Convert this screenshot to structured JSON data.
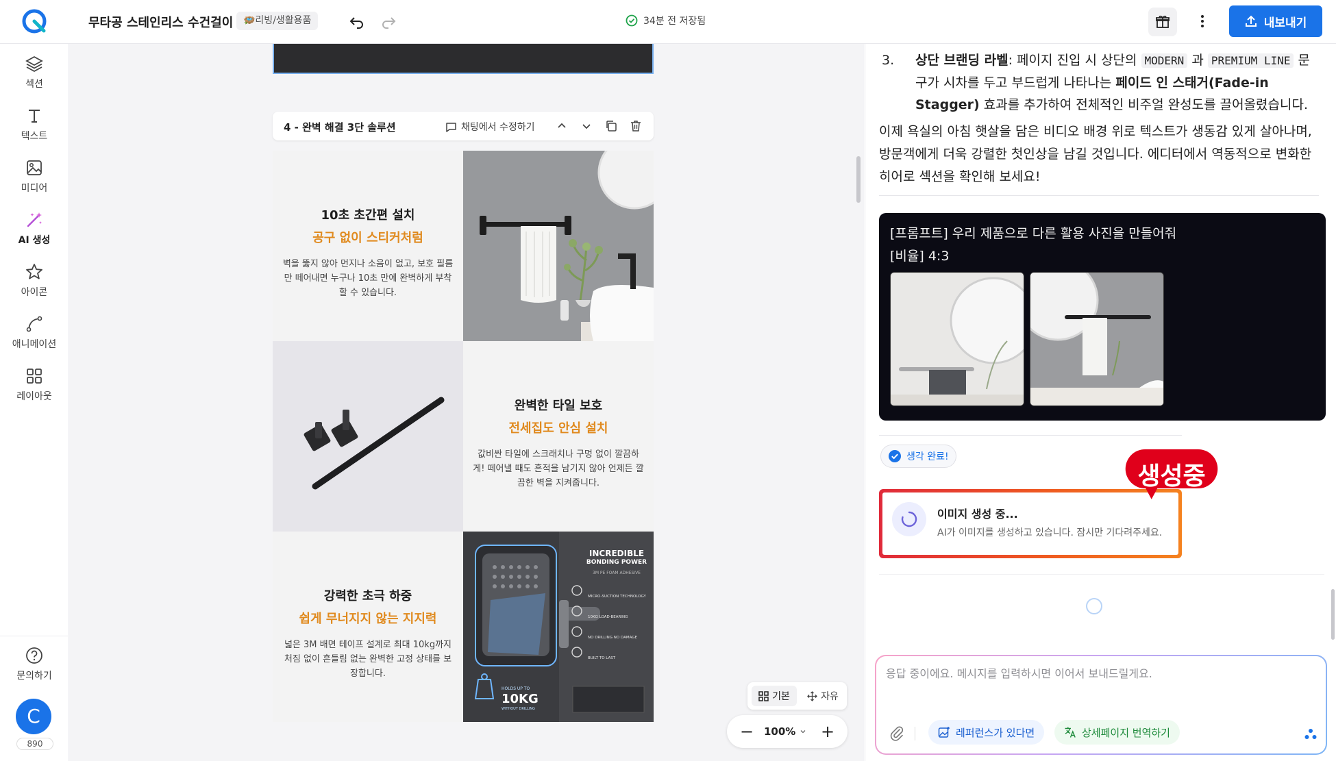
{
  "topbar": {
    "doc_title": "무타공 스테인리스 수건걸이",
    "category": "🪺리빙/생활용품",
    "save_status": "34분 전 저장됨",
    "export_label": "내보내기"
  },
  "sidebar": {
    "items": [
      {
        "label": "섹션",
        "icon": "layers-icon"
      },
      {
        "label": "텍스트",
        "icon": "text-icon"
      },
      {
        "label": "미디어",
        "icon": "image-icon"
      },
      {
        "label": "AI 생성",
        "icon": "magic-wand-icon"
      },
      {
        "label": "아이콘",
        "icon": "star-icon"
      },
      {
        "label": "애니메이션",
        "icon": "curve-icon"
      },
      {
        "label": "레이아웃",
        "icon": "grid-icon"
      }
    ],
    "help_label": "문의하기",
    "avatar_initial": "C",
    "credits": "890",
    "ai_color": "#b44fd6"
  },
  "canvas": {
    "section_title": "4 - 완벽 해결 3단 솔루션",
    "edit_in_chat": "채팅에서 수정하기",
    "features": [
      {
        "title": "10초 초간편 설치",
        "subtitle": "공구 없이 스티커처럼",
        "body": "벽을 뚫지 않아 먼지나 소음이 없고, 보호 필름만 떼어내면 누구나 10초 만에 완벽하게 부착할 수 있습니다."
      },
      {
        "title": "완벽한 타일 보호",
        "subtitle": "전세집도 안심 설치",
        "body": "값비싼 타일에 스크래치나 구멍 없이 깔끔하게! 떼어낼 때도 흔적을 남기지 않아 언제든 깔끔한 벽을 지켜줍니다."
      },
      {
        "title": "강력한 초극 하중",
        "subtitle": "쉽게 무너지지 않는 지지력",
        "body": "넓은 3M 배면 테이프 설계로 최대 10kg까지 처짐 없이 흔들림 없는 완벽한 고정 상태를 보장합니다."
      }
    ],
    "poster": {
      "headline": "INCREDIBLE",
      "headline2": "BONDING POWER",
      "tagline": "3M PE FOAM ADHESIVE",
      "specs": [
        "MICRO-SUCTION TECHNOLOGY",
        "10KG LOAD-BEARING",
        "NO DRILLING NO DAMAGE",
        "BUILT TO LAST"
      ],
      "holds_label": "HOLDS UP TO",
      "weight": "10KG",
      "weight_sub": "WITHOUT DRILLING"
    },
    "view_basic": "기본",
    "view_free": "자유",
    "zoom": "100%",
    "accent_orange": "#e08a1e"
  },
  "chat": {
    "list_num": "3.",
    "list_bold": "상단 브랜딩 라벨",
    "list_text1": ": 페이지 진입 시 상단의 ",
    "code1": "MODERN",
    "list_and": " 과 ",
    "code2": "PREMIUM LINE",
    "list_text2": " 문구가 시차를 두고 부드럽게 나타나는 ",
    "list_bold2": "페이드 인 스태거(Fade-in Stagger)",
    "list_text3": " 효과를 추가하여 전체적인 비주얼 완성도를 끌어올렸습니다.",
    "paragraph": "이제 욕실의 아침 햇살을 담은 비디오 배경 위로 텍스트가 생동감 있게 살아나며, 방문객에게 더욱 강렬한 첫인상을 남길 것입니다. 에디터에서 역동적으로 변화한 히어로 섹션을 확인해 보세요!",
    "prompt_line1": "[프롬프트] 우리 제품으로 다른 활용 사진을 만들어줘",
    "prompt_line2": "[비율] 4:3",
    "thinking_done": "생각 완료!",
    "gen_title": "이미지 생성 중...",
    "gen_desc": "AI가 이미지를 생성하고 있습니다. 잠시만 기다려주세요.",
    "badge": "생성중",
    "input_placeholder": "응답 중이에요. 메시지를 입력하시면 이어서 보내드릴게요.",
    "chip_reference": "레퍼런스가 있다면",
    "chip_translate": "상세페이지 번역하기",
    "brand_blue": "#1a73e8",
    "badge_red": "#e0001b"
  }
}
